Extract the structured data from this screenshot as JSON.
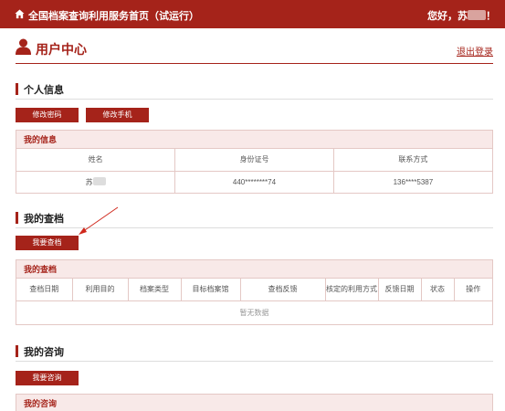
{
  "topbar": {
    "home_title": "全国档案查询利用服务首页（试运行）",
    "greeting_prefix": "您好，苏",
    "greeting_suffix": "！"
  },
  "user_center": {
    "title": "用户中心",
    "logout_label": "退出登录"
  },
  "personal_info": {
    "section_title": "个人信息",
    "change_password_label": "修改密码",
    "change_phone_label": "修改手机",
    "table_title": "我的信息",
    "columns": [
      "姓名",
      "身份证号",
      "联系方式"
    ],
    "row": {
      "name": "苏",
      "id_number": "440********74",
      "phone": "136****5387"
    }
  },
  "my_queries": {
    "section_title": "我的查档",
    "action_label": "我要查档",
    "table_title": "我的查档",
    "columns": [
      "查档日期",
      "利用目的",
      "档案类型",
      "目标档案馆",
      "查档反馈",
      "核定的利用方式",
      "反馈日期",
      "状态",
      "操作"
    ],
    "empty_text": "暂无数据"
  },
  "my_consultations": {
    "section_title": "我的咨询",
    "action_label": "我要咨询",
    "table_title": "我的咨询"
  },
  "colors": {
    "brand": "#a5231a",
    "header_bg": "#f8e9e8",
    "border": "#e4c8c5"
  }
}
